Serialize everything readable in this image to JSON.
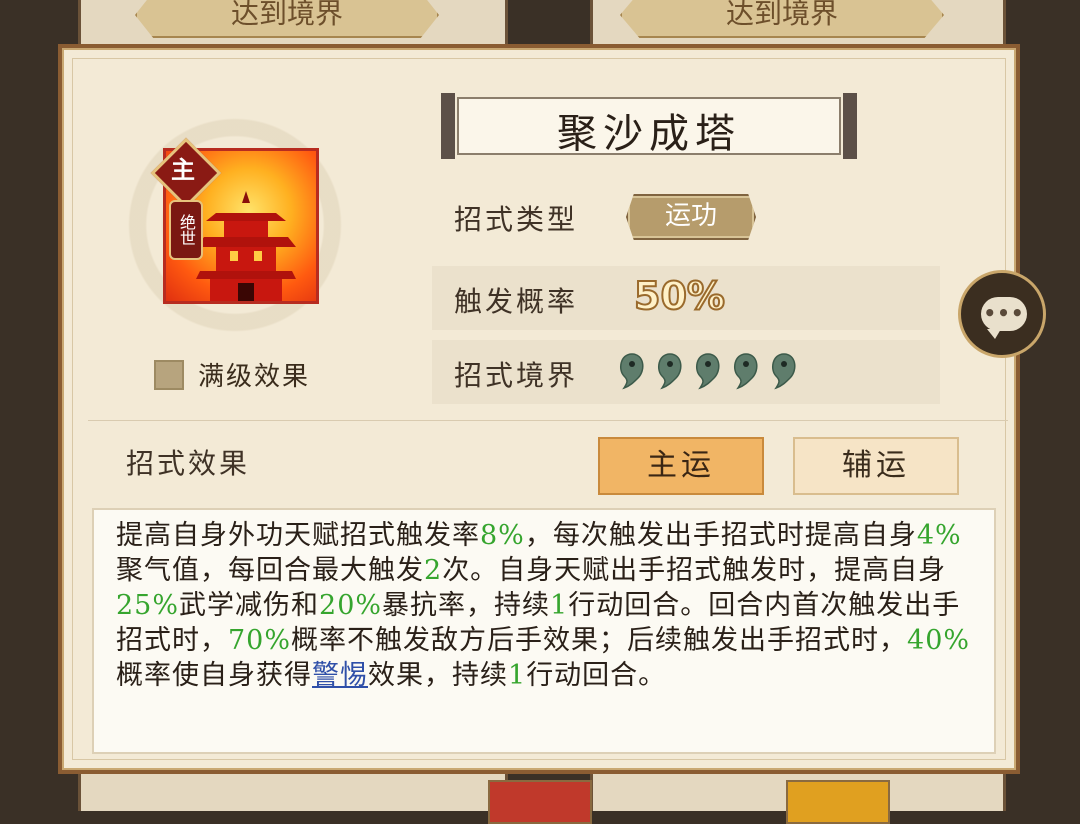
{
  "background": {
    "left_tag": "达到境界",
    "right_tag": "达到境界"
  },
  "skill": {
    "name": "聚沙成塔",
    "icon": "pagoda-icon",
    "badge_main": "主",
    "badge_tier": "绝世",
    "max_level_label": "满级效果"
  },
  "attributes": {
    "type_label": "招式类型",
    "type_value": "运功",
    "trigger_label": "触发概率",
    "trigger_value": "50%",
    "realm_label": "招式境界",
    "realm_level": 5
  },
  "effect": {
    "header": "招式效果",
    "tabs": [
      {
        "label": "主运",
        "selected": true
      },
      {
        "label": "辅运",
        "selected": false
      }
    ],
    "segments": [
      {
        "t": "提高自身外功天赋招式触发率"
      },
      {
        "t": "8%",
        "hl": "green"
      },
      {
        "t": "，每次触发出手招式时提高自身"
      },
      {
        "t": "4%",
        "hl": "green"
      },
      {
        "t": "聚气值，每回合最大触发"
      },
      {
        "t": "2",
        "hl": "green"
      },
      {
        "t": "次。自身天赋出手招式触发时，提高自身"
      },
      {
        "t": "25%",
        "hl": "green"
      },
      {
        "t": "武学减伤和"
      },
      {
        "t": "20%",
        "hl": "green"
      },
      {
        "t": "暴抗率，持续"
      },
      {
        "t": "1",
        "hl": "green"
      },
      {
        "t": "行动回合。回合内首次触发出手招式时，"
      },
      {
        "t": "70%",
        "hl": "green"
      },
      {
        "t": "概率不触发敌方后手效果；后续触发出手招式时，"
      },
      {
        "t": "40%",
        "hl": "green"
      },
      {
        "t": "概率使自身获得"
      },
      {
        "t": "警惕",
        "hl": "link"
      },
      {
        "t": "效果，持续"
      },
      {
        "t": "1",
        "hl": "green"
      },
      {
        "t": "行动回合。"
      }
    ]
  },
  "colors": {
    "highlight_green": "#36a52e",
    "link_blue": "#2f4fa8",
    "tab_selected": "#f1b565",
    "dialog_bg": "#f3ead6"
  }
}
